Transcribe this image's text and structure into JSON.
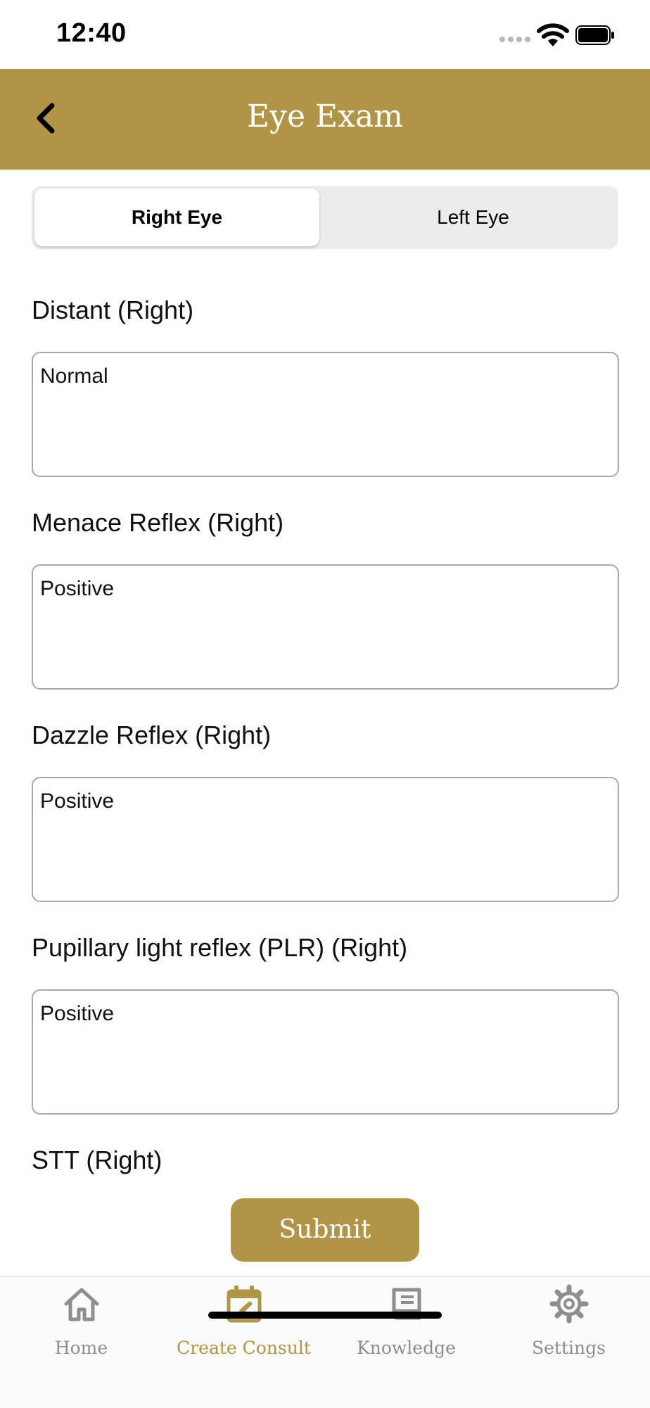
{
  "status_bar": {
    "time": "12:40"
  },
  "nav": {
    "title": "Eye Exam"
  },
  "segments": {
    "right": "Right Eye",
    "left": "Left Eye"
  },
  "fields": [
    {
      "label": "Distant (Right)",
      "value": "Normal"
    },
    {
      "label": "Menace Reflex (Right)",
      "value": "Positive"
    },
    {
      "label": "Dazzle Reflex (Right)",
      "value": "Positive"
    },
    {
      "label": "Pupillary light reflex (PLR) (Right)",
      "value": "Positive"
    },
    {
      "label": "STT (Right)"
    }
  ],
  "submit_label": "Submit",
  "tabbar": {
    "items": [
      {
        "label": "Home",
        "icon": "home-icon"
      },
      {
        "label": "Create Consult",
        "icon": "calendar-edit-icon",
        "active": true
      },
      {
        "label": "Knowledge",
        "icon": "book-icon"
      },
      {
        "label": "Settings",
        "icon": "gear-icon"
      }
    ]
  },
  "colors": {
    "accent": "#b09448",
    "inactive": "#8e8e8e"
  }
}
